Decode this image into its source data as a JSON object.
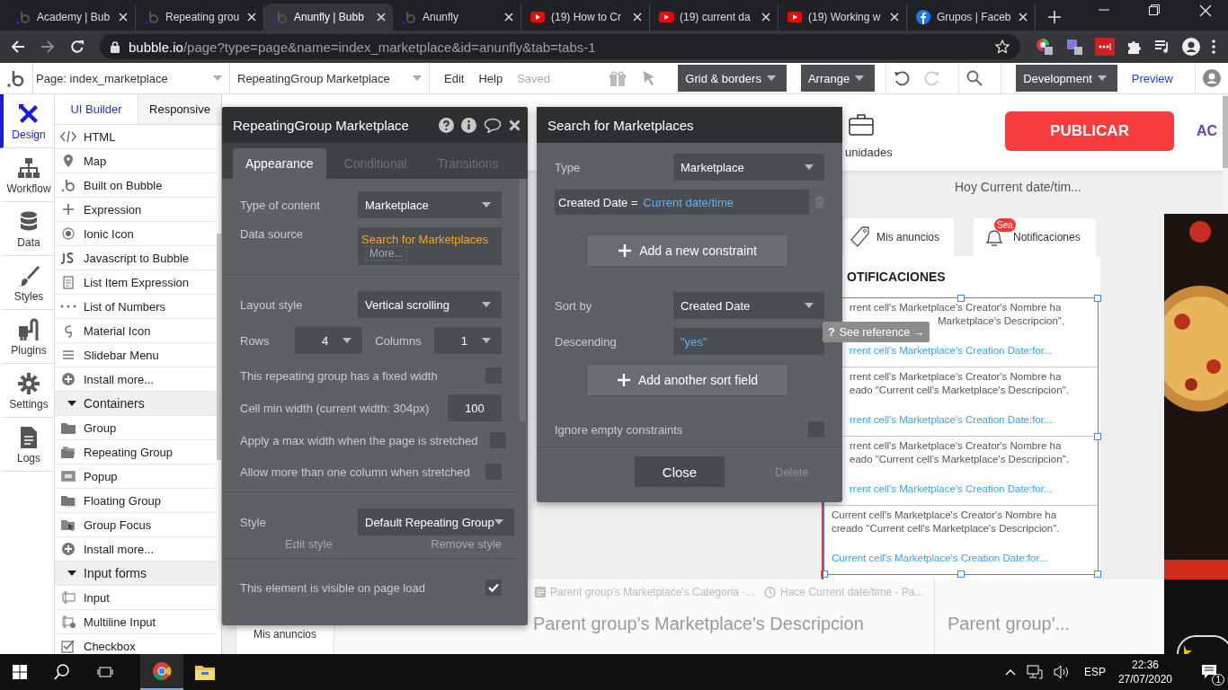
{
  "browser": {
    "tabs": [
      {
        "title": "Academy | Bub",
        "selected": false
      },
      {
        "title": "Repeating grou",
        "selected": false
      },
      {
        "title": "Anunfly | Bubb",
        "selected": true
      },
      {
        "title": "Anunfly",
        "selected": false
      },
      {
        "title": "(19) How to Cr",
        "selected": false
      },
      {
        "title": "(19) current da",
        "selected": false
      },
      {
        "title": "(19) Working w",
        "selected": false
      },
      {
        "title": "Grupos | Faceb",
        "selected": false
      }
    ],
    "url_host": "bubble.io",
    "url_path": "/page?type=page&name=index_marketplace&id=anunfly&tab=tabs-1"
  },
  "toolbar": {
    "page_selector": "Page: index_marketplace",
    "element_selector": "RepeatingGroup Marketplace",
    "menu": [
      "Edit",
      "Help"
    ],
    "save_status": "Saved",
    "view_menus": [
      "Grid & borders",
      "Arrange"
    ],
    "mode": "Development",
    "preview": "Preview"
  },
  "rail": [
    {
      "label": "Design",
      "selected": true
    },
    {
      "label": "Workflow",
      "selected": false
    },
    {
      "label": "Data",
      "selected": false
    },
    {
      "label": "Styles",
      "selected": false
    },
    {
      "label": "Plugins",
      "selected": false
    },
    {
      "label": "Settings",
      "selected": false
    },
    {
      "label": "Logs",
      "selected": false
    }
  ],
  "elements_panel": {
    "tabs": [
      {
        "label": "UI Builder",
        "selected": true
      },
      {
        "label": "Responsive",
        "selected": false
      }
    ],
    "items": [
      {
        "kind": "item",
        "label": "HTML"
      },
      {
        "kind": "item",
        "label": "Map"
      },
      {
        "kind": "item",
        "label": "Built on Bubble"
      },
      {
        "kind": "item",
        "label": "Expression"
      },
      {
        "kind": "item",
        "label": "Ionic Icon"
      },
      {
        "kind": "item",
        "label": "Javascript to Bubble"
      },
      {
        "kind": "item",
        "label": "List Item Expression"
      },
      {
        "kind": "item",
        "label": "List of Numbers"
      },
      {
        "kind": "item",
        "label": "Material Icon"
      },
      {
        "kind": "item",
        "label": "Slidebar Menu"
      },
      {
        "kind": "item",
        "label": "Install more..."
      },
      {
        "kind": "section",
        "label": "Containers",
        "expanded": true
      },
      {
        "kind": "item",
        "label": "Group"
      },
      {
        "kind": "item",
        "label": "Repeating Group"
      },
      {
        "kind": "item",
        "label": "Popup"
      },
      {
        "kind": "item",
        "label": "Floating Group"
      },
      {
        "kind": "item",
        "label": "Group Focus"
      },
      {
        "kind": "item",
        "label": "Install more..."
      },
      {
        "kind": "section",
        "label": "Input forms",
        "expanded": true
      },
      {
        "kind": "item",
        "label": "Input"
      },
      {
        "kind": "item",
        "label": "Multiline Input"
      },
      {
        "kind": "item",
        "label": "Checkbox"
      }
    ]
  },
  "canvas": {
    "header_label": "unidades",
    "publish_button": "PUBLICAR",
    "header_link": "AC",
    "date_line": "Hoy Current date/tim...",
    "tabs": [
      {
        "label": "Mis anuncios"
      },
      {
        "label": "Notificaciones",
        "badge": "Sea"
      }
    ],
    "notifications_title": "OTIFICACIONES",
    "cells": [
      {
        "lines": [
          "rrent cell's Marketplace's Creator's Nombre ha",
          "Marketplace's Descripcion\"."
        ],
        "link": "rrent cell's Marketplace's Creation Date:for..."
      },
      {
        "lines": [
          "rrent cell's Marketplace's Creator's Nombre ha",
          "eado \"Current cell's Marketplace's Descripcion\"."
        ],
        "link": "rrent cell's Marketplace's Creation Date:for..."
      },
      {
        "lines": [
          "rrent cell's Marketplace's Creator's Nombre ha",
          "eado \"Current cell's Marketplace's Descripcion\"."
        ],
        "link": "rrent cell's Marketplace's Creation Date:for..."
      },
      {
        "lines": [
          "Current cell's Marketplace's Creator's Nombre ha",
          "creado \"Current cell's Marketplace's Descripcion\"."
        ],
        "link": "Current cell's Marketplace's Creation Date:for..."
      }
    ],
    "tooltip": {
      "icon": "?",
      "label": "See reference →"
    },
    "bottom": {
      "card_label": "Mis anuncios",
      "category": "Parent group's Marketplace's Categoria ·...",
      "time": "Hace Current date/time - Pa...",
      "description": "Parent group's Marketplace's Descripcion",
      "side_title": "Parent group'..."
    }
  },
  "properties": {
    "title": "RepeatingGroup Marketplace",
    "tabs": [
      {
        "label": "Appearance",
        "selected": true
      },
      {
        "label": "Conditional",
        "selected": false
      },
      {
        "label": "Transitions",
        "selected": false
      }
    ],
    "type_of_content": {
      "label": "Type of content",
      "value": "Marketplace"
    },
    "data_source": {
      "label": "Data source",
      "value": "Search for Marketplaces",
      "more": "More..."
    },
    "layout_style": {
      "label": "Layout style",
      "value": "Vertical scrolling"
    },
    "rows": {
      "label": "Rows",
      "value": "4"
    },
    "columns": {
      "label": "Columns",
      "value": "1"
    },
    "options": [
      {
        "kind": "checkbox",
        "label": "This repeating group has a fixed width",
        "checked": false
      },
      {
        "kind": "number",
        "label": "Cell min width (current width: 304px)",
        "value": "100"
      },
      {
        "kind": "checkbox",
        "label": "Apply a max width when the page is stretched",
        "checked": false
      },
      {
        "kind": "checkbox",
        "label": "Allow more than one column when stretched",
        "checked": false
      }
    ],
    "style": {
      "label": "Style",
      "value": "Default Repeating Group",
      "edit": "Edit style",
      "remove": "Remove style"
    },
    "visible": {
      "label": "This element is visible on page load",
      "checked": true
    }
  },
  "search_panel": {
    "title": "Search for Marketplaces",
    "type": {
      "label": "Type",
      "value": "Marketplace"
    },
    "constraint": {
      "field": "Created Date =",
      "value": "Current date/time"
    },
    "add_constraint": "Add a new constraint",
    "sort_by": {
      "label": "Sort by",
      "value": "Created Date"
    },
    "descending": {
      "label": "Descending",
      "value": "\"yes\""
    },
    "add_sort": "Add another sort field",
    "ignore_empty": {
      "label": "Ignore empty constraints",
      "checked": false
    },
    "close": "Close",
    "delete": {
      "label": "Delete",
      "disabled": true
    }
  },
  "taskbar": {
    "language": "ESP",
    "time": "22:36",
    "date": "27/07/2020",
    "notifications": "1"
  }
}
